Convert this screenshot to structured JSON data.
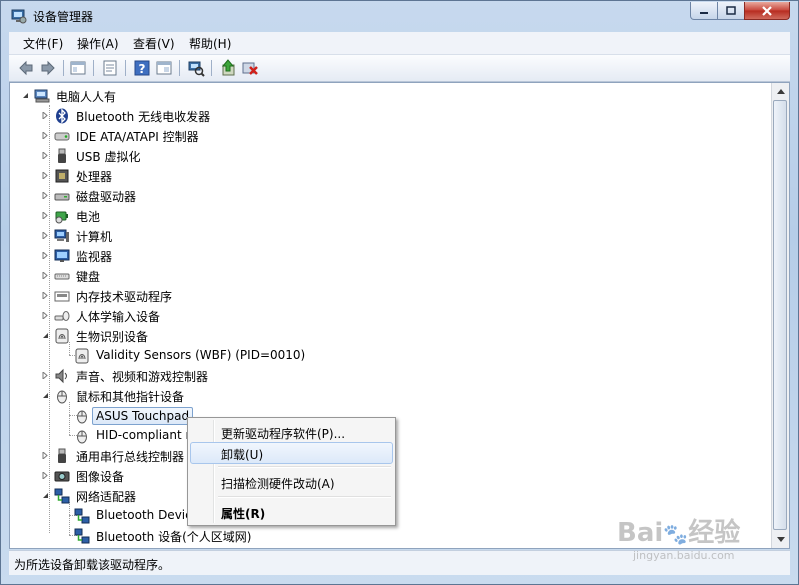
{
  "window": {
    "title": "设备管理器"
  },
  "menu": [
    "文件(F)",
    "操作(A)",
    "查看(V)",
    "帮助(H)"
  ],
  "toolbar": {
    "buttons": [
      "back-icon",
      "forward-icon",
      "up-level-icon",
      "properties-view-icon",
      "help-icon",
      "show-hidden-icon",
      "scan-hardware-icon",
      "update-driver-icon",
      "uninstall-icon"
    ]
  },
  "tree": {
    "root": "电脑人人有",
    "items": [
      {
        "label": "Bluetooth 无线电收发器",
        "icon": "bluetooth-icon",
        "expanded": false
      },
      {
        "label": "IDE ATA/ATAPI 控制器",
        "icon": "ide-controller-icon",
        "expanded": false
      },
      {
        "label": "USB 虚拟化",
        "icon": "usb-icon",
        "expanded": false
      },
      {
        "label": "处理器",
        "icon": "processor-icon",
        "expanded": false
      },
      {
        "label": "磁盘驱动器",
        "icon": "disk-drive-icon",
        "expanded": false
      },
      {
        "label": "电池",
        "icon": "battery-icon",
        "expanded": false
      },
      {
        "label": "计算机",
        "icon": "computer-icon",
        "expanded": false
      },
      {
        "label": "监视器",
        "icon": "monitor-icon",
        "expanded": false
      },
      {
        "label": "键盘",
        "icon": "keyboard-icon",
        "expanded": false
      },
      {
        "label": "内存技术驱动程序",
        "icon": "memory-icon",
        "expanded": false
      },
      {
        "label": "人体学输入设备",
        "icon": "hid-icon",
        "expanded": false
      },
      {
        "label": "生物识别设备",
        "icon": "biometric-icon",
        "expanded": true,
        "children": [
          "Validity Sensors (WBF) (PID=0010)"
        ]
      },
      {
        "label": "声音、视频和游戏控制器",
        "icon": "sound-icon",
        "expanded": false
      },
      {
        "label": "鼠标和其他指针设备",
        "icon": "mouse-icon",
        "expanded": true,
        "children": [
          "ASUS Touchpad",
          "HID-compliant mouse"
        ]
      },
      {
        "label": "通用串行总线控制器",
        "icon": "usb-controller-icon",
        "expanded": false
      },
      {
        "label": "图像设备",
        "icon": "camera-icon",
        "expanded": false
      },
      {
        "label": "网络适配器",
        "icon": "network-icon",
        "expanded": true,
        "children": [
          "Bluetooth Device (RFCOMM Protocol TDI)",
          "Bluetooth 设备(个人区域网)"
        ]
      }
    ]
  },
  "context_menu": {
    "items": [
      "更新驱动程序软件(P)...",
      "卸载(U)",
      "扫描检测硬件改动(A)",
      "属性(R)"
    ],
    "highlighted": "卸载(U)"
  },
  "status": "为所选设备卸载该驱动程序。",
  "watermark": {
    "brand": "Bai",
    "brand2": "经验",
    "url": "jingyan.baidu.com"
  }
}
